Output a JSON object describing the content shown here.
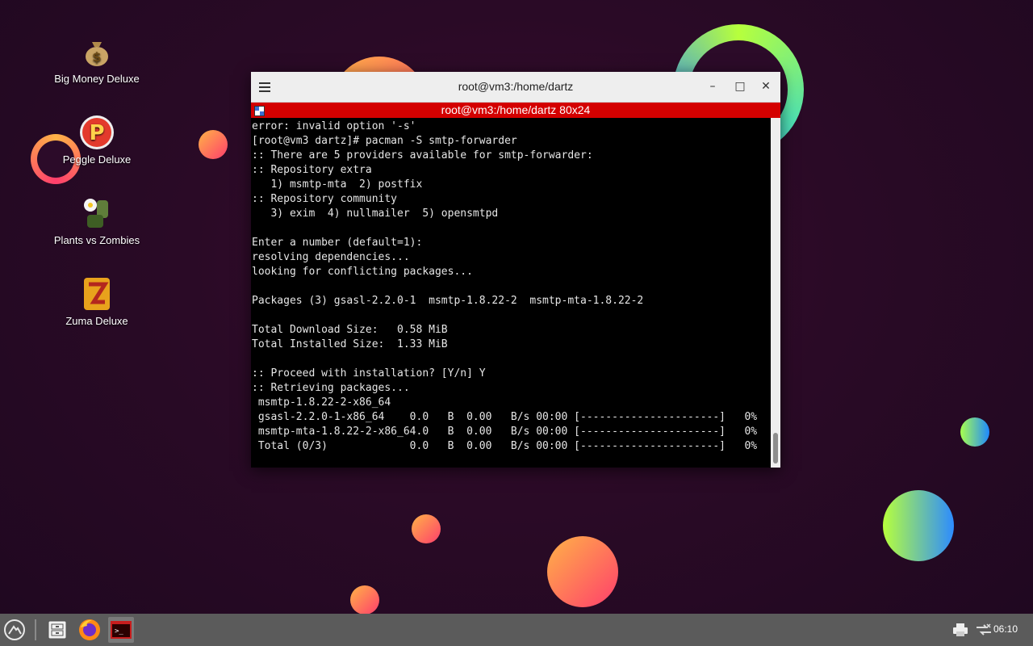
{
  "desktop": {
    "icons": [
      {
        "label": "Big Money Deluxe",
        "icon": "money-bag-icon"
      },
      {
        "label": "Peggle Deluxe",
        "icon": "peggle-icon"
      },
      {
        "label": "Plants vs Zombies",
        "icon": "plants-vs-zombies-icon"
      },
      {
        "label": "Zuma Deluxe",
        "icon": "zuma-icon"
      }
    ]
  },
  "window": {
    "title": "root@vm3:/home/dartz",
    "tab_title": "root@vm3:/home/dartz 80x24",
    "buttons": {
      "minimize": "–",
      "maximize": "□",
      "close": "✕"
    },
    "terminal_lines": [
      "error: invalid option '-s'",
      "[root@vm3 dartz]# pacman -S smtp-forwarder",
      ":: There are 5 providers available for smtp-forwarder:",
      ":: Repository extra",
      "   1) msmtp-mta  2) postfix",
      ":: Repository community",
      "   3) exim  4) nullmailer  5) opensmtpd",
      "",
      "Enter a number (default=1):",
      "resolving dependencies...",
      "looking for conflicting packages...",
      "",
      "Packages (3) gsasl-2.2.0-1  msmtp-1.8.22-2  msmtp-mta-1.8.22-2",
      "",
      "Total Download Size:   0.58 MiB",
      "Total Installed Size:  1.33 MiB",
      "",
      ":: Proceed with installation? [Y/n] Y",
      ":: Retrieving packages...",
      " msmtp-1.8.22-2-x86_64",
      " gsasl-2.2.0-1-x86_64    0.0   B  0.00   B/s 00:00 [----------------------]   0%",
      " msmtp-mta-1.8.22-2-x86_64.0   B  0.00   B/s 00:00 [----------------------]   0%",
      " Total (0/3)             0.0   B  0.00   B/s 00:00 [----------------------]   0%"
    ]
  },
  "taskbar": {
    "start_icon": "start-menu-icon",
    "apps": [
      "file-manager-icon",
      "firefox-icon",
      "terminal-icon"
    ],
    "tray": [
      "printer-icon",
      "network-icon"
    ],
    "clock": "06:10"
  },
  "colors": {
    "tab_bar": "#d40000",
    "titlebar": "#eeeeee",
    "taskbar": "#5b5b5b",
    "terminal_bg": "#000000"
  }
}
